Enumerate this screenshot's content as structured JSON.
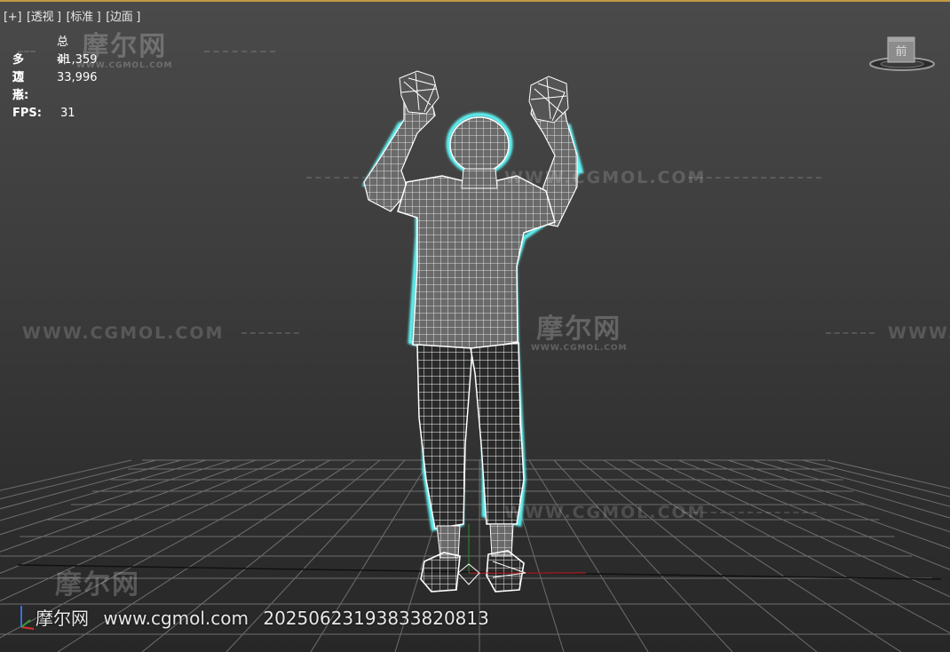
{
  "viewport_menu": {
    "plus": "[+]",
    "view": "[透视 ]",
    "shading": "[标准 ]",
    "display": "[边面 ]"
  },
  "stats": {
    "header": "总计",
    "polys_label": "多边形:",
    "polys_value": "41,359",
    "verts_label": "顶点:",
    "verts_value": "33,996",
    "fps_label": "FPS:",
    "fps_value": "31"
  },
  "watermark": {
    "url_caps": "WWW.CGMOL.COM",
    "logo_cn": "摩尔网",
    "logo_url": "WWW.CGMOL.COM"
  },
  "footer": {
    "site_cn": "摩尔网",
    "site_url": "www.cgmol.com",
    "id": "20250623193833820813"
  },
  "viewcube": {
    "face_label": "前",
    "icon": "viewcube-icon"
  },
  "colors": {
    "accent_border": "#c49a45",
    "selection_cyan": "#5ff4f4",
    "wire_white": "#ffffff",
    "grid": "#6e6e6e"
  }
}
